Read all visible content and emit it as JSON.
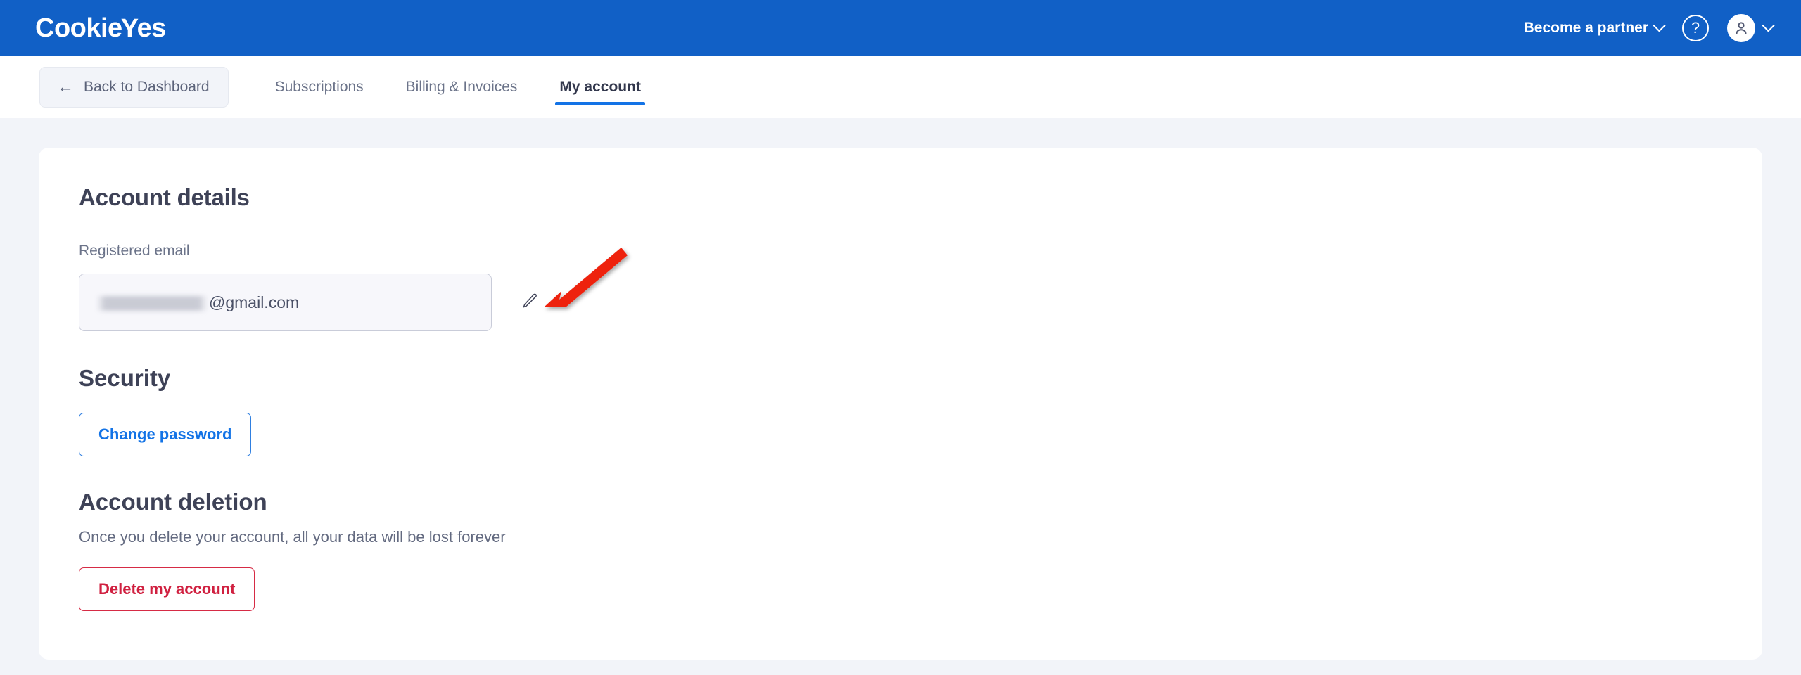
{
  "header": {
    "brand_prefix": "Cookie",
    "brand_check": "Y",
    "brand_suffix": "es",
    "partner_label": "Become a partner",
    "help_glyph": "?",
    "partner_icon": "chevron-down-icon",
    "help_icon": "help-circle-icon",
    "avatar_icon": "user-avatar-icon",
    "accent_color": "#1160C6"
  },
  "nav": {
    "back_label": "Back to Dashboard",
    "back_icon": "arrow-left-icon",
    "tabs": [
      {
        "label": "Subscriptions",
        "active": false
      },
      {
        "label": "Billing & Invoices",
        "active": false
      },
      {
        "label": "My account",
        "active": true
      }
    ],
    "active_underline_color": "#1373E6"
  },
  "account_details": {
    "title": "Account details",
    "email_label": "Registered email",
    "email_redacted": "",
    "email_domain": "@gmail.com",
    "edit_icon": "pencil-edit-icon"
  },
  "security": {
    "title": "Security",
    "change_password_label": "Change password",
    "button_color": "#1373E6"
  },
  "account_deletion": {
    "title": "Account deletion",
    "description": "Once you delete your account, all your data will be lost forever",
    "delete_label": "Delete my account",
    "button_color": "#D02040"
  },
  "annotation": {
    "arrow_icon": "red-pointer-arrow",
    "color": "#EE2211"
  }
}
